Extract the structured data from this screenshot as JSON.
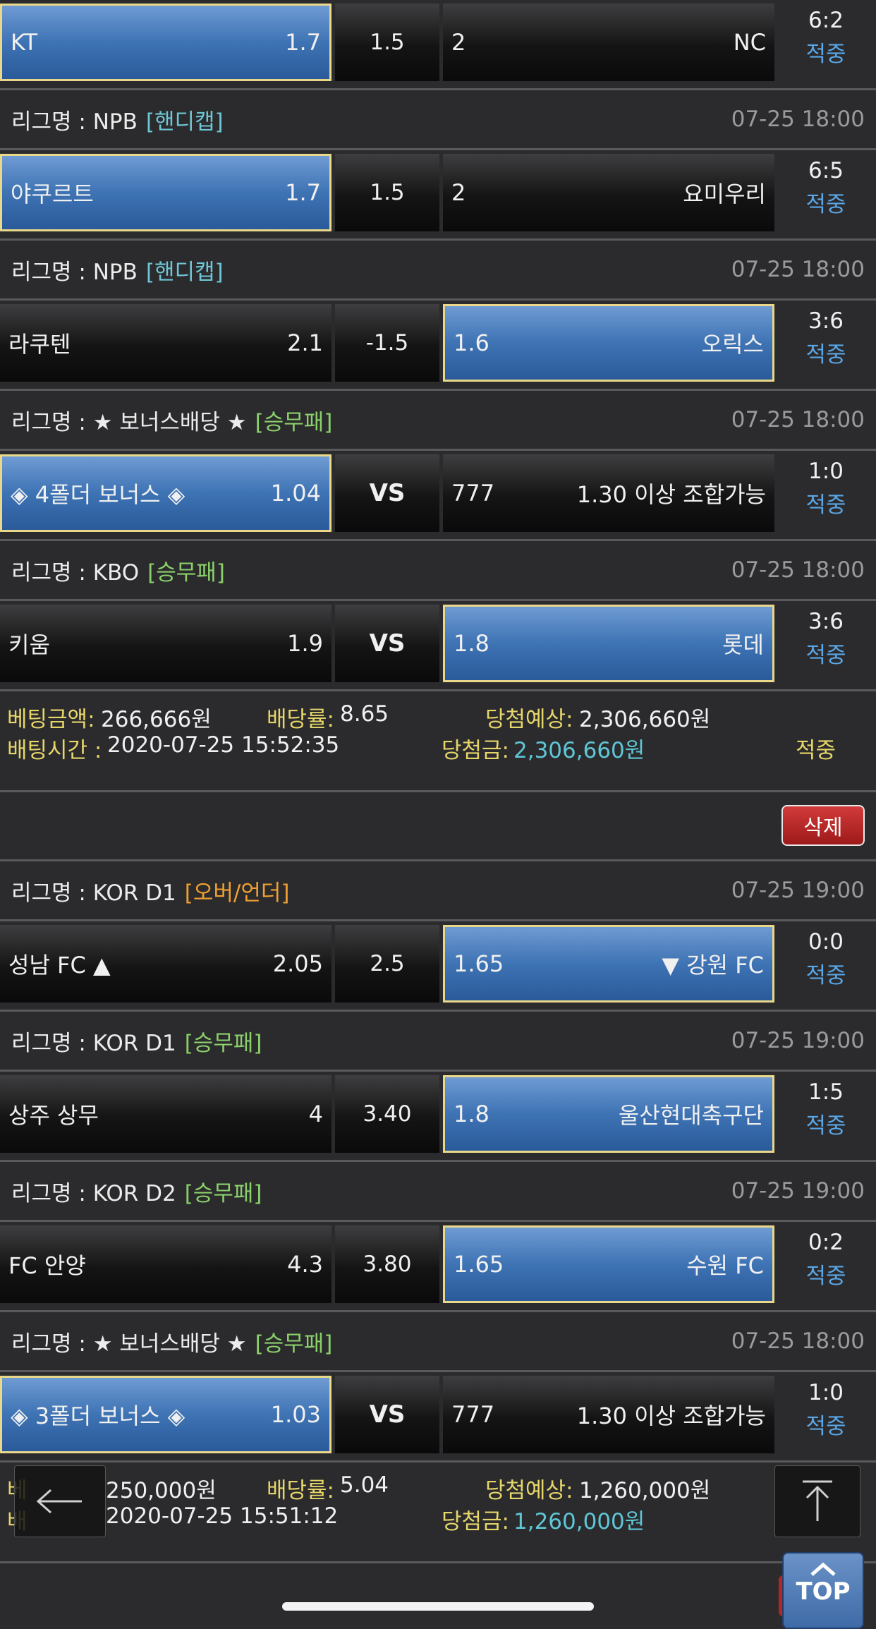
{
  "slip1": {
    "rows": [
      {
        "league": null,
        "time": null,
        "match": {
          "home": "KT",
          "home_odds": "1.7",
          "mid": "1.5",
          "away_odds": "2",
          "away": "NC",
          "selected": "home",
          "score": "6:2",
          "result": "적중"
        }
      },
      {
        "league": "리그명 : NPB",
        "tag": "[핸디캡]",
        "tag_type": "hdc",
        "time": "07-25 18:00",
        "match": {
          "home": "야쿠르트",
          "home_odds": "1.7",
          "mid": "1.5",
          "away_odds": "2",
          "away": "요미우리",
          "selected": "home",
          "score": "6:5",
          "result": "적중"
        }
      },
      {
        "league": "리그명 : NPB",
        "tag": "[핸디캡]",
        "tag_type": "hdc",
        "time": "07-25 18:00",
        "match": {
          "home": "라쿠텐",
          "home_odds": "2.1",
          "mid": "-1.5",
          "away_odds": "1.6",
          "away": "오릭스",
          "selected": "away",
          "score": "3:6",
          "result": "적중"
        }
      },
      {
        "league": "리그명 : ★ 보너스배당 ★",
        "tag": "[승무패]",
        "tag_type": "wdl",
        "time": "07-25 18:00",
        "match": {
          "home": "◈ 4폴더 보너스 ◈",
          "home_odds": "1.04",
          "mid": "VS",
          "away_odds": "777",
          "away": "1.30 이상 조합가능",
          "selected": "home",
          "score": "1:0",
          "result": "적중"
        }
      },
      {
        "league": "리그명 : KBO",
        "tag": "[승무패]",
        "tag_type": "wdl",
        "time": "07-25 18:00",
        "match": {
          "home": "키움",
          "home_odds": "1.9",
          "mid": "VS",
          "away_odds": "1.8",
          "away": "롯데",
          "selected": "away",
          "score": "3:6",
          "result": "적중"
        }
      }
    ],
    "summary": {
      "amount_label": "베팅금액:",
      "amount": "266,666원",
      "rate_label": "배당률:",
      "rate": "8.65",
      "expected_label": "당첨예상:",
      "expected": "2,306,660원",
      "time_label": "배팅시간 :",
      "time": "2020-07-25 15:52:35",
      "win_label": "당첨금:",
      "win": "2,306,660원",
      "status": "적중"
    }
  },
  "delete_label": "삭제",
  "slip2": {
    "rows": [
      {
        "league": "리그명 : KOR D1",
        "tag": "[오버/언더]",
        "tag_type": "ou",
        "time": "07-25 19:00",
        "match": {
          "home": "성남 FC ▲",
          "home_odds": "2.05",
          "mid": "2.5",
          "away_odds": "1.65",
          "away": "▼ 강원 FC",
          "selected": "away",
          "score": "0:0",
          "result": "적중"
        }
      },
      {
        "league": "리그명 : KOR D1",
        "tag": "[승무패]",
        "tag_type": "wdl",
        "time": "07-25 19:00",
        "match": {
          "home": "상주 상무",
          "home_odds": "4",
          "mid": "3.40",
          "away_odds": "1.8",
          "away": "울산현대축구단",
          "selected": "away",
          "score": "1:5",
          "result": "적중"
        }
      },
      {
        "league": "리그명 : KOR D2",
        "tag": "[승무패]",
        "tag_type": "wdl",
        "time": "07-25 19:00",
        "match": {
          "home": "FC 안양",
          "home_odds": "4.3",
          "mid": "3.80",
          "away_odds": "1.65",
          "away": "수원 FC",
          "selected": "away",
          "score": "0:2",
          "result": "적중"
        }
      },
      {
        "league": "리그명 : ★ 보너스배당 ★",
        "tag": "[승무패]",
        "tag_type": "wdl",
        "time": "07-25 18:00",
        "match": {
          "home": "◈ 3폴더 보너스 ◈",
          "home_odds": "1.03",
          "mid": "VS",
          "away_odds": "777",
          "away": "1.30 이상 조합가능",
          "selected": "home",
          "score": "1:0",
          "result": "적중"
        }
      }
    ],
    "summary": {
      "amount_label": "베",
      "amount": "250,000원",
      "rate_label": "배당률:",
      "rate": "5.04",
      "expected_label": "당첨예상:",
      "expected": "1,260,000원",
      "time_label": "배",
      "time": "2020-07-25 15:51:12",
      "win_label": "당첨금:",
      "win": "1,260,000원",
      "status": ""
    }
  },
  "floating": {
    "back_icon": "arrow-left-icon",
    "scroll_top_icon": "arrow-up-bar-icon",
    "top_label": "TOP"
  }
}
